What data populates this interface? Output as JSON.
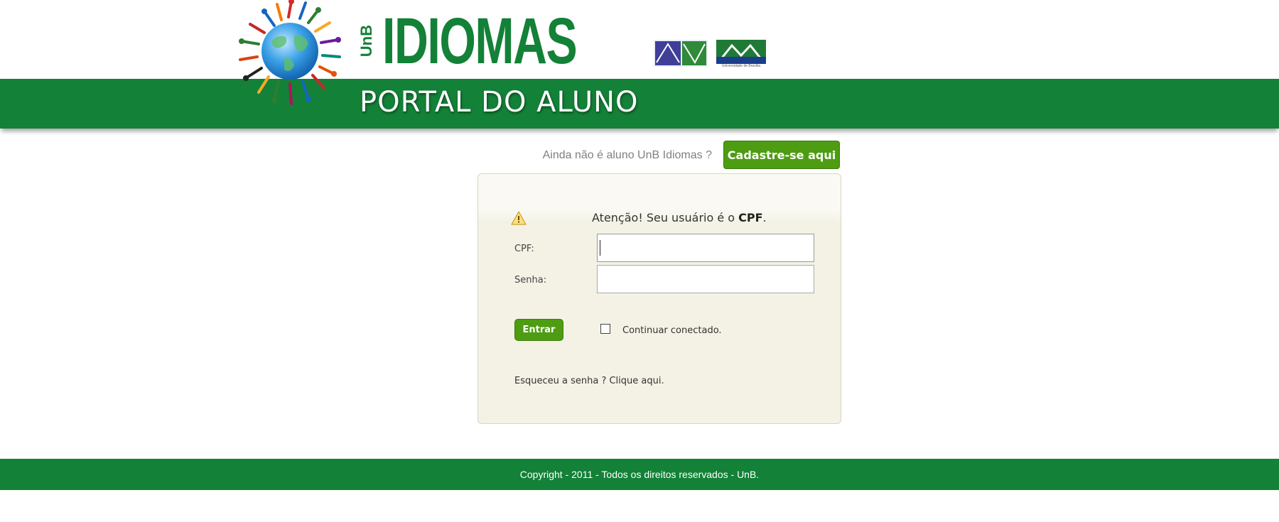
{
  "header": {
    "brand_vertical": "UnB",
    "brand_title": "IDIOMAS",
    "subtitle": "PORTAL DO ALUNO",
    "logo_caption": "Universidade de Brasília",
    "band_color": "#138137"
  },
  "register": {
    "prompt": "Ainda não é aluno UnB Idiomas ?",
    "button_label": "Cadastre-se aqui"
  },
  "login": {
    "warning_prefix": "Atenção! Seu usuário é o ",
    "warning_strong": "CPF",
    "warning_suffix": ".",
    "warning_icon": "warning-triangle-icon",
    "cpf_label": "CPF:",
    "cpf_value": "",
    "senha_label": "Senha:",
    "senha_value": "",
    "enter_label": "Entrar",
    "remember_label": "Continuar conectado.",
    "remember_checked": false,
    "forgot_text": "Esqueceu a senha ? Clique aqui."
  },
  "footer": {
    "text": "Copyright - 2011 - Todos os direitos reservados - UnB."
  },
  "colors": {
    "brand_green": "#138137",
    "button_green": "#4d9c12",
    "panel_bg": "#f4f2e5"
  }
}
